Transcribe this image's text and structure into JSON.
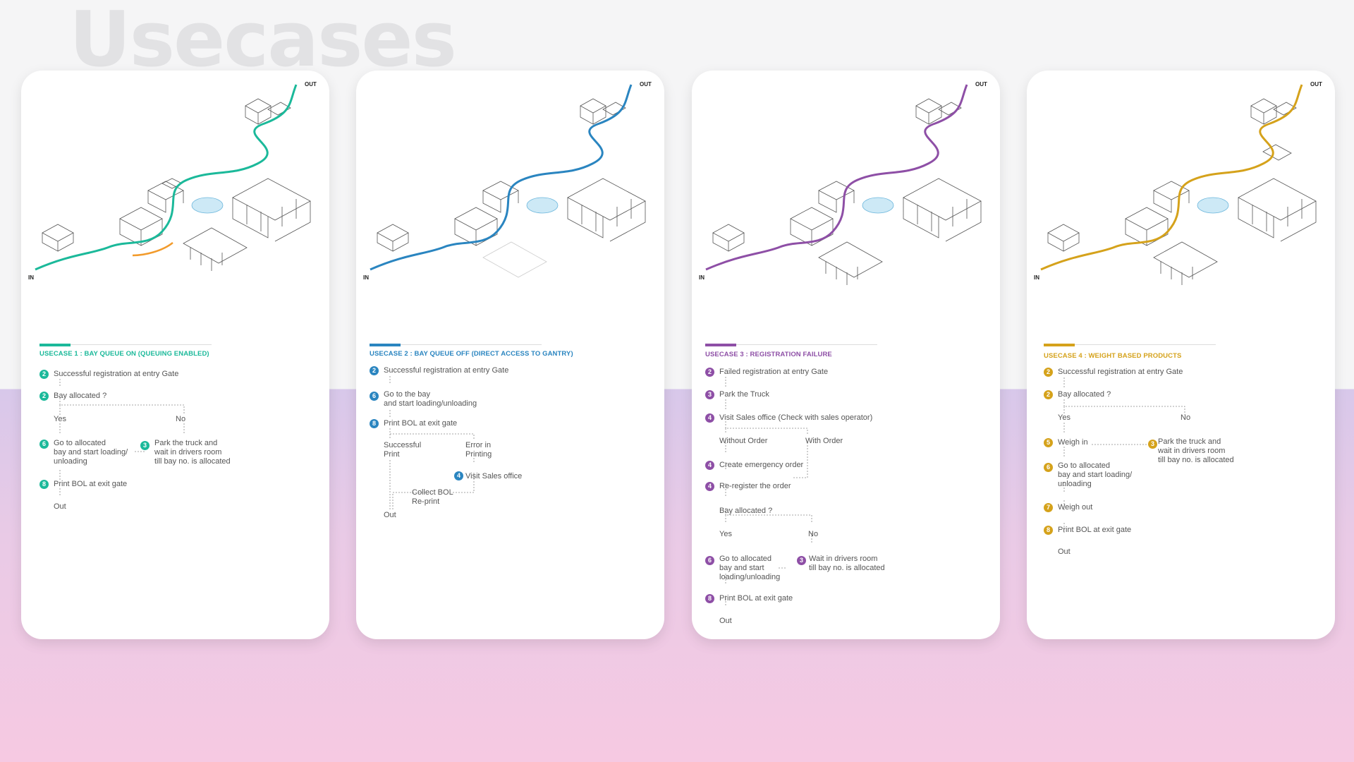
{
  "page_title": "Usecases",
  "map_labels": {
    "in": "IN",
    "out": "OUT"
  },
  "cards": [
    {
      "title": "USECASE 1 : BAY QUEUE ON (QUEUING ENABLED)",
      "color": "#1bb99a",
      "steps": {
        "s1": {
          "num": "2",
          "text": "Successful registration at entry Gate"
        },
        "s2": {
          "num": "2",
          "text": "Bay allocated ?"
        },
        "yes": "Yes",
        "no": "No",
        "s3": {
          "num": "6",
          "text1": "Go to allocated",
          "text2": "bay and start loading/",
          "text3": "unloading"
        },
        "s4": {
          "num": "3",
          "text1": "Park the truck and",
          "text2": "wait in drivers room",
          "text3": "till bay no. is allocated"
        },
        "s5": {
          "num": "8",
          "text": "Print BOL at exit gate"
        },
        "out": "Out"
      }
    },
    {
      "title": "USECASE 2 : BAY QUEUE OFF (DIRECT ACCESS TO GANTRY)",
      "color": "#2a85c0",
      "steps": {
        "s1": {
          "num": "2",
          "text": "Successful registration at entry Gate"
        },
        "s2": {
          "num": "6",
          "text1": "Go to the bay",
          "text2": "and start loading/unloading"
        },
        "s3": {
          "num": "8",
          "text": "Print BOL at exit gate"
        },
        "succ1": "Successful",
        "succ2": "Print",
        "err1": "Error in",
        "err2": "Printing",
        "s4": {
          "num": "4",
          "text": "Visit Sales office"
        },
        "col1": "Collect BOL",
        "col2": "Re-print",
        "out": "Out"
      }
    },
    {
      "title": "USECASE 3 : REGISTRATION FAILURE",
      "color": "#8e4fa6",
      "steps": {
        "s1": {
          "num": "2",
          "text": "Failed registration at entry Gate"
        },
        "s2": {
          "num": "3",
          "text": "Park the Truck"
        },
        "s3": {
          "num": "4",
          "text": "Visit Sales office (Check with sales operator)"
        },
        "without": "Without Order",
        "with": "With Order",
        "s4": {
          "num": "4",
          "text": "Create emergency order"
        },
        "s5": {
          "num": "4",
          "text": "Re-register the order"
        },
        "bay": "Bay allocated ?",
        "yes": "Yes",
        "no": "No",
        "s6": {
          "num": "6",
          "text1": "Go to allocated",
          "text2": "bay and start",
          "text3": "loading/unloading"
        },
        "s7": {
          "num": "3",
          "text1": "Wait in drivers room",
          "text2": "till bay no. is allocated"
        },
        "s8": {
          "num": "8",
          "text": "Print BOL at exit gate"
        },
        "out": "Out"
      }
    },
    {
      "title": "USECASE 4 : WEIGHT BASED PRODUCTS",
      "color": "#d5a21b",
      "steps": {
        "s1": {
          "num": "2",
          "text": "Successful registration at entry Gate"
        },
        "s2": {
          "num": "2",
          "text": "Bay allocated ?"
        },
        "yes": "Yes",
        "no": "No",
        "s3": {
          "num": "5",
          "text": "Weigh in"
        },
        "s4": {
          "num": "3",
          "text1": "Park the truck and",
          "text2": "wait in drivers room",
          "text3": "till bay no. is allocated"
        },
        "s5": {
          "num": "6",
          "text1": "Go to allocated",
          "text2": "bay and start loading/",
          "text3": "unloading"
        },
        "s6": {
          "num": "7",
          "text": "Weigh out"
        },
        "s7": {
          "num": "8",
          "text": "Print BOL at exit gate"
        },
        "out": "Out"
      }
    }
  ]
}
